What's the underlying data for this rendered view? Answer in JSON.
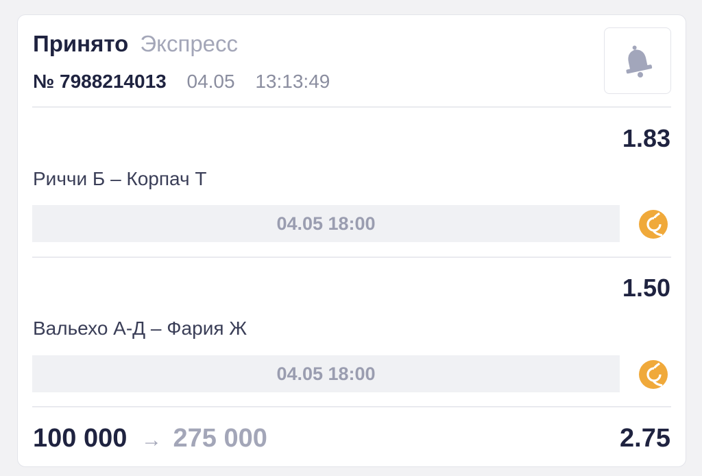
{
  "header": {
    "status": "Принято",
    "bet_type": "Экспресс",
    "bet_number": "№ 7988214013",
    "date": "04.05",
    "time": "13:13:49",
    "bell_icon": "bell-icon"
  },
  "events": [
    {
      "odds": "1.83",
      "name": "Риччи Б – Корпач Т",
      "start": "04.05 18:00",
      "sport_icon": "tennis-ball-icon"
    },
    {
      "odds": "1.50",
      "name": "Вальехо А-Д – Фария Ж",
      "start": "04.05 18:00",
      "sport_icon": "tennis-ball-icon"
    }
  ],
  "footer": {
    "stake": "100 000",
    "arrow": "→",
    "payout": "275 000",
    "total_odds": "2.75"
  },
  "colors": {
    "primary_text": "#1f2340",
    "secondary_text": "#a3a6b8",
    "tennis_ball": "#f0a93a"
  }
}
